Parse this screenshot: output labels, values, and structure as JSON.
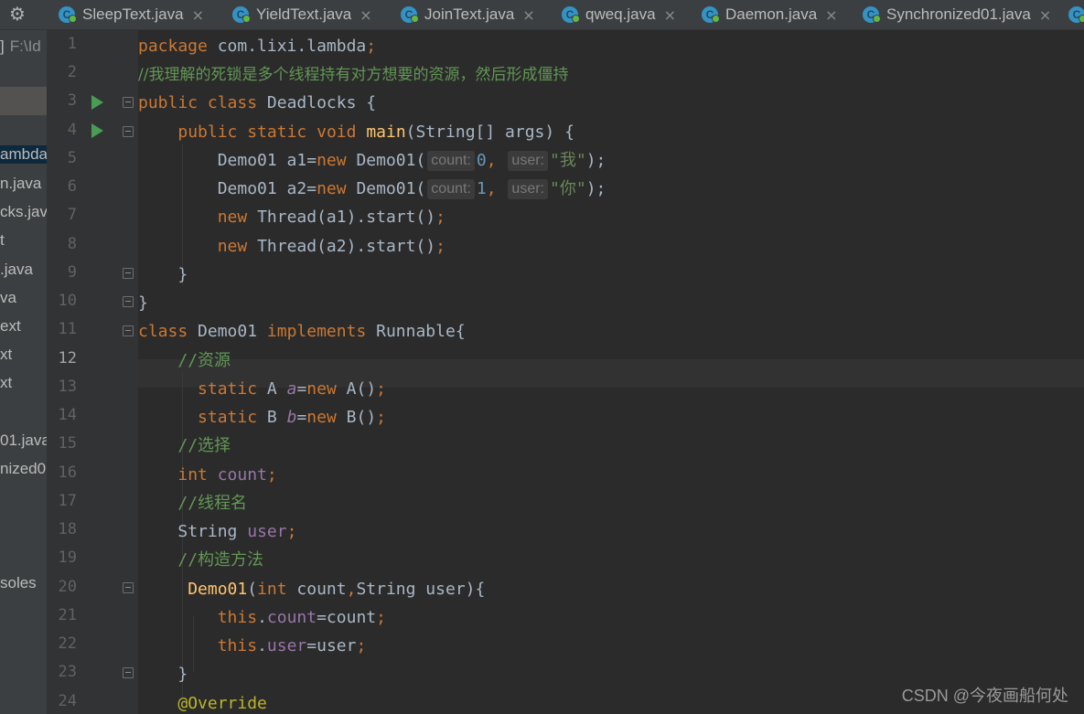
{
  "tabs": [
    {
      "label": "SleepText.java"
    },
    {
      "label": "YieldText.java"
    },
    {
      "label": "JoinText.java"
    },
    {
      "label": "qweq.java"
    },
    {
      "label": "Daemon.java"
    },
    {
      "label": "Synchronized01.java"
    }
  ],
  "tab_close_glyph": "×",
  "project_panel": {
    "header_bracket": "]",
    "header_path": "F:\\Id",
    "items": [
      "ambda",
      "n.java",
      "cks.java",
      "t",
      ".java",
      "va",
      "ext",
      "xt",
      "xt",
      "01.java",
      "nized0",
      "soles"
    ]
  },
  "editor": {
    "current_line": 12,
    "line_numbers": [
      "1",
      "2",
      "3",
      "4",
      "5",
      "6",
      "7",
      "8",
      "9",
      "10",
      "11",
      "12",
      "13",
      "14",
      "15",
      "16",
      "17",
      "18",
      "19",
      "20",
      "21",
      "22",
      "23",
      "24"
    ],
    "lines": {
      "l1": {
        "kw": "package",
        "pkg": " com.lixi.lambda",
        "semi": ";"
      },
      "l2": {
        "comment": "//我理解的死锁是多个线程持有对方想要的资源，然后形成僵持"
      },
      "l3": {
        "kw1": "public",
        "kw2": "class",
        "name": "Deadlocks",
        "brace": "{"
      },
      "l4": {
        "kw1": "public",
        "kw2": "static",
        "kw3": "void",
        "fn": "main",
        "params": "(String[] args) {"
      },
      "l5": {
        "decl": "Demo01 a1=",
        "kw": "new",
        "ctor": "Demo01(",
        "hint1": "count:",
        "num": "0",
        "hint2": "user:",
        "str": "\"我\"",
        "end": ");"
      },
      "l6": {
        "decl": "Demo01 a2=",
        "kw": "new",
        "ctor": "Demo01(",
        "hint1": "count:",
        "num": "1",
        "hint2": "user:",
        "str": "\"你\"",
        "end": ");"
      },
      "l7": {
        "kw": "new",
        "rest": "Thread(a1).start()",
        "semi": ";"
      },
      "l8": {
        "kw": "new",
        "rest": "Thread(a2).start()",
        "semi": ";"
      },
      "l9": {
        "text": "}"
      },
      "l10": {
        "text": "}"
      },
      "l11": {
        "kw1": "class",
        "name": "Demo01",
        "kw2": "implements",
        "iface": "Runnable{"
      },
      "l12": {
        "comment": "//资源"
      },
      "l13": {
        "kw": "static",
        "type": "A",
        "field": "a",
        "eq": "=",
        "kw2": "new",
        "ctor": "A()",
        "semi": ";"
      },
      "l14": {
        "kw": "static",
        "type": "B",
        "field": "b",
        "eq": "=",
        "kw2": "new",
        "ctor": "B()",
        "semi": ";"
      },
      "l15": {
        "comment": "//选择"
      },
      "l16": {
        "kw": "int",
        "field": "count",
        "semi": ";"
      },
      "l17": {
        "comment": "//线程名"
      },
      "l18": {
        "type": "String",
        "field": "user",
        "semi": ";"
      },
      "l19": {
        "comment": "//构造方法"
      },
      "l20": {
        "fn": "Demo01",
        "open": "(",
        "kw": "int",
        "p1": " count",
        "comma": ",",
        "p2": "String user){"
      },
      "l21": {
        "kw": "this",
        "dot": ".",
        "field": "count",
        "rest": "=count",
        "semi": ";"
      },
      "l22": {
        "kw": "this",
        "dot": ".",
        "field": "user",
        "rest": "=user",
        "semi": ";"
      },
      "l23": {
        "text": "}"
      },
      "l24": {
        "ann": "@Override"
      }
    }
  },
  "watermark": "CSDN @今夜画船何处",
  "colors": {
    "background": "#2b2b2b",
    "keyword": "#cc7832",
    "comment": "#629755",
    "string": "#6a8759",
    "number": "#6897bb",
    "method": "#ffc66d",
    "field": "#9876aa"
  }
}
